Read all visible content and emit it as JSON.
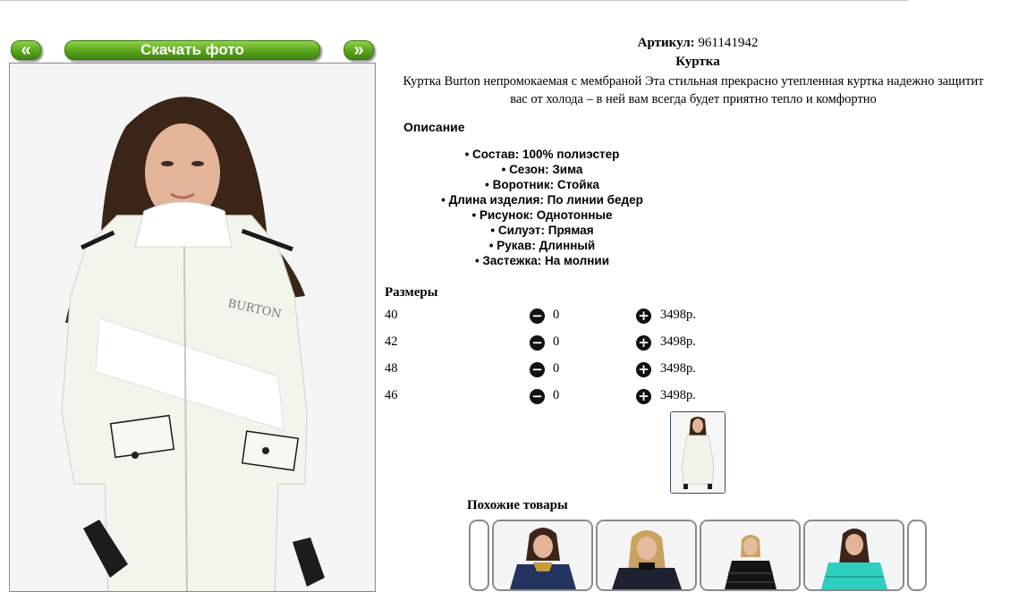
{
  "gallery": {
    "prev_label": "«",
    "download_label": "Скачать фото",
    "next_label": "»",
    "brand_print": "BURTON"
  },
  "product": {
    "article_label": "Артикул:",
    "article_value": "961141942",
    "title": "Куртка",
    "description": "Куртка Burton непромокаемая с мембраной Эта стильная прекрасно утепленная куртка надежно защитит вас от холода – в ней вам всегда будет приятно тепло и комфортно"
  },
  "details": {
    "label": "Описание",
    "items": [
      "Состав: 100% полиэстер",
      "Сезон: Зима",
      "Воротник: Стойка",
      "Длина изделия: По линии бедер",
      "Рисунок: Однотонные",
      "Силуэт: Прямая",
      "Рукав: Длинный",
      "Застежка: На молнии"
    ]
  },
  "sizes": {
    "label": "Размеры",
    "rows": [
      {
        "size": "40",
        "qty": "0",
        "price": "3498р."
      },
      {
        "size": "42",
        "qty": "0",
        "price": "3498р."
      },
      {
        "size": "48",
        "qty": "0",
        "price": "3498р."
      },
      {
        "size": "46",
        "qty": "0",
        "price": "3498р."
      }
    ]
  },
  "similar": {
    "label": "Похожие товары"
  },
  "icons": {
    "decrease": "minus-circle-icon",
    "increase": "plus-circle-icon"
  },
  "colors": {
    "button_green": "#5aa51c",
    "frame_border": "#8a8a8a",
    "jacket_white": "#f1f4ea",
    "teal_jacket": "#2fcfc0",
    "navy_jacket": "#24345e"
  }
}
